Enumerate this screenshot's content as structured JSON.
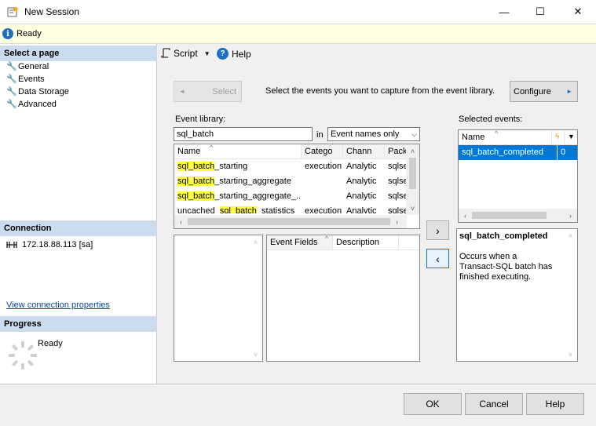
{
  "window": {
    "title": "New Session",
    "minimize_glyph": "—",
    "maximize_glyph": "☐",
    "close_glyph": "✕"
  },
  "status": {
    "text": "Ready",
    "icon": "info-icon"
  },
  "left": {
    "select_page_header": "Select a page",
    "pages": [
      {
        "label": "General"
      },
      {
        "label": "Events"
      },
      {
        "label": "Data Storage"
      },
      {
        "label": "Advanced"
      }
    ],
    "connection_header": "Connection",
    "connection_value": "172.18.88.113 [sa]",
    "view_connection_link": "View connection properties",
    "progress_header": "Progress",
    "progress_status": "Ready"
  },
  "toolbar": {
    "script_label": "Script",
    "help_label": "Help"
  },
  "events": {
    "select_button": "Select",
    "instructions": "Select the events you want to capture from the event library.",
    "configure_button": "Configure",
    "library_label": "Event library:",
    "search_value": "sql_batch",
    "in_label": "in",
    "filter_selected": "Event names only",
    "library_columns": [
      "Name",
      "Catego",
      "Chann",
      "Pack"
    ],
    "library_rows": [
      {
        "name_hl": "sql_batch",
        "name_rest": "_starting",
        "category": "execution",
        "channel": "Analytic",
        "package": "sqlse"
      },
      {
        "name_hl": "sql_batch",
        "name_rest": "_starting_aggregate",
        "category": "",
        "channel": "Analytic",
        "package": "sqlse"
      },
      {
        "name_hl": "sql_batch",
        "name_rest": "_starting_aggregate_...",
        "category": "",
        "channel": "Analytic",
        "package": "sqlse"
      },
      {
        "name_pre": "uncached_",
        "name_hl": "sql_batch",
        "name_rest": "_statistics",
        "category": "execution",
        "channel": "Analytic",
        "package": "sqlse"
      }
    ],
    "fields_columns": [
      "Event Fields",
      "Description"
    ],
    "add_button": "›",
    "remove_button": "‹",
    "selected_label": "Selected events:",
    "selected_columns": [
      "Name"
    ],
    "selected_rows": [
      {
        "name": "sql_batch_completed",
        "value": "0"
      }
    ],
    "detail_title": "sql_batch_completed",
    "detail_description": "Occurs when a Transact-SQL batch has finished executing."
  },
  "footer": {
    "ok": "OK",
    "cancel": "Cancel",
    "help": "Help"
  },
  "colors": {
    "accent": "#0078d7",
    "section_header": "#ccdcef",
    "highlight": "#ffff3c",
    "status_bg": "#ffffe1"
  }
}
